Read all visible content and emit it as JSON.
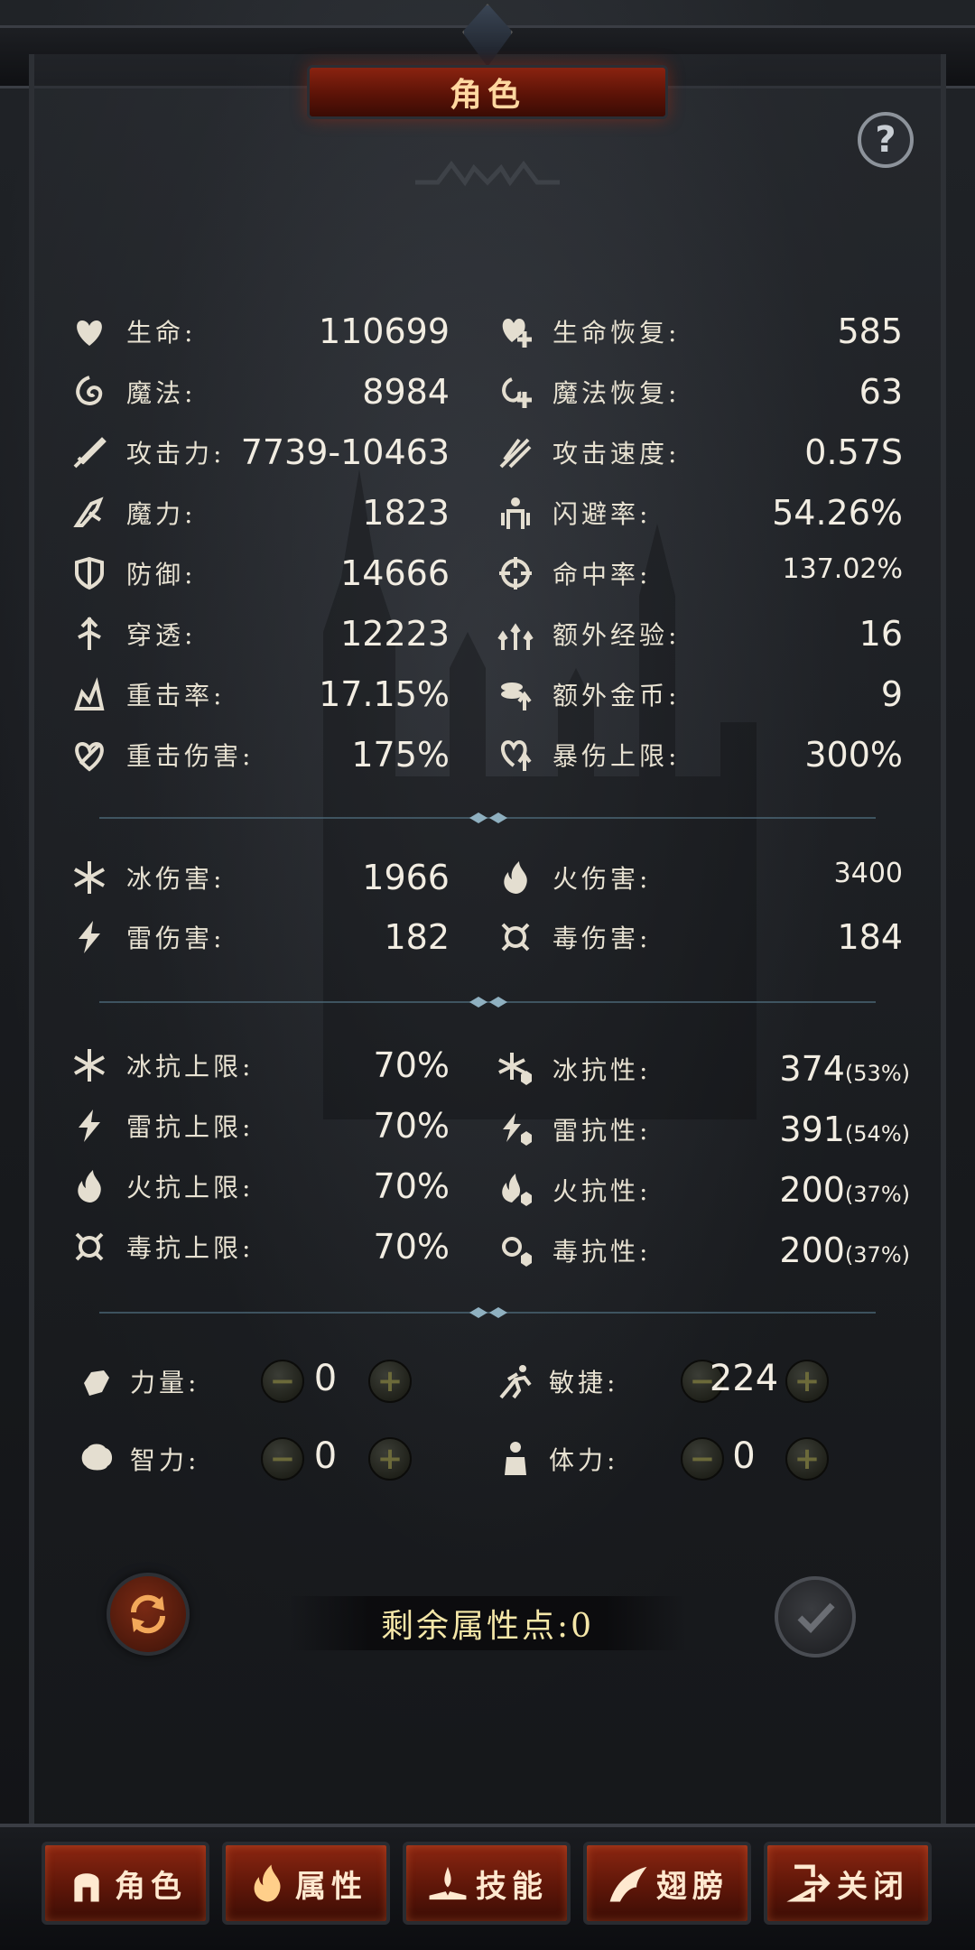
{
  "header": {
    "title": "角色"
  },
  "help": {
    "symbol": "?"
  },
  "stats_left": [
    {
      "icon": "heart-icon",
      "label": "生命:",
      "value": "110699"
    },
    {
      "icon": "mana-swirl-icon",
      "label": "魔法:",
      "value": "8984"
    },
    {
      "icon": "sword-icon",
      "label": "攻击力:",
      "value": "7739-10463"
    },
    {
      "icon": "magic-power-icon",
      "label": "魔力:",
      "value": "1823"
    },
    {
      "icon": "shield-icon",
      "label": "防御:",
      "value": "14666"
    },
    {
      "icon": "pierce-icon",
      "label": "穿透:",
      "value": "12223"
    },
    {
      "icon": "crit-rate-icon",
      "label": "重击率:",
      "value": "17.15%"
    },
    {
      "icon": "crit-damage-icon",
      "label": "重击伤害:",
      "value": "175%"
    }
  ],
  "stats_right": [
    {
      "icon": "life-regen-icon",
      "label": "生命恢复:",
      "value": "585"
    },
    {
      "icon": "mana-regen-icon",
      "label": "魔法恢复:",
      "value": "63"
    },
    {
      "icon": "attack-speed-icon",
      "label": "攻击速度:",
      "value": "0.57S"
    },
    {
      "icon": "dodge-icon",
      "label": "闪避率:",
      "value": "54.26%"
    },
    {
      "icon": "crosshair-icon",
      "label": "命中率:",
      "value": "137.02%"
    },
    {
      "icon": "extra-exp-icon",
      "label": "额外经验:",
      "value": "16"
    },
    {
      "icon": "extra-gold-icon",
      "label": "额外金币:",
      "value": "9"
    },
    {
      "icon": "crit-cap-icon",
      "label": "暴伤上限:",
      "value": "300%"
    }
  ],
  "element_damage": [
    {
      "icon": "snowflake-icon",
      "label": "冰伤害:",
      "value": "1966"
    },
    {
      "icon": "flame-icon",
      "label": "火伤害:",
      "value": "3400"
    },
    {
      "icon": "lightning-icon",
      "label": "雷伤害:",
      "value": "182"
    },
    {
      "icon": "poison-icon",
      "label": "毒伤害:",
      "value": "184"
    }
  ],
  "resist_caps": [
    {
      "icon": "ice-resist-cap-icon",
      "label": "冰抗上限:",
      "value": "70%"
    },
    {
      "icon": "thunder-resist-cap-icon",
      "label": "雷抗上限:",
      "value": "70%"
    },
    {
      "icon": "fire-resist-cap-icon",
      "label": "火抗上限:",
      "value": "70%"
    },
    {
      "icon": "poison-resist-cap-icon",
      "label": "毒抗上限:",
      "value": "70%"
    }
  ],
  "resists": [
    {
      "icon": "ice-resist-icon",
      "label": "冰抗性:",
      "value": "374",
      "pct": "(53%)"
    },
    {
      "icon": "thunder-resist-icon",
      "label": "雷抗性:",
      "value": "391",
      "pct": "(54%)"
    },
    {
      "icon": "fire-resist-icon",
      "label": "火抗性:",
      "value": "200",
      "pct": "(37%)"
    },
    {
      "icon": "poison-resist-icon",
      "label": "毒抗性:",
      "value": "200",
      "pct": "(37%)"
    }
  ],
  "attributes": [
    {
      "icon": "strength-icon",
      "label": "力量:",
      "value": "0"
    },
    {
      "icon": "agility-icon",
      "label": "敏捷:",
      "value": "224"
    },
    {
      "icon": "intelligence-icon",
      "label": "智力:",
      "value": "0"
    },
    {
      "icon": "stamina-icon",
      "label": "体力:",
      "value": "0"
    }
  ],
  "buttons": {
    "minus": "−",
    "plus": "+"
  },
  "remaining_points": "剩余属性点:0",
  "nav": [
    {
      "icon": "helmet-icon",
      "label": "角色"
    },
    {
      "icon": "flame-body-icon",
      "label": "属性"
    },
    {
      "icon": "book-skill-icon",
      "label": "技能"
    },
    {
      "icon": "wings-icon",
      "label": "翅膀"
    },
    {
      "icon": "exit-door-icon",
      "label": "关闭"
    }
  ],
  "colors": {
    "accent_red": "#8b2611",
    "gold_text": "#f5e7a8",
    "title_text": "#ffd7a0"
  }
}
